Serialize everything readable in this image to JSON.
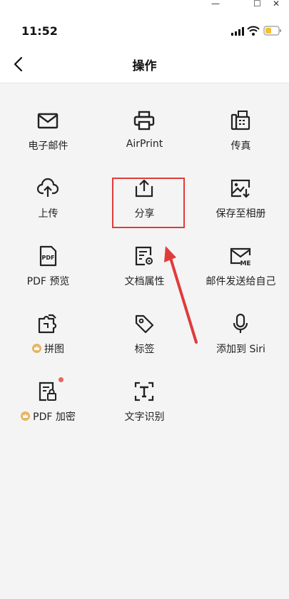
{
  "window": {
    "minimize": "—",
    "maximize": "☐",
    "close": "✕"
  },
  "status_bar": {
    "time": "11:52"
  },
  "nav": {
    "title": "操作"
  },
  "items": [
    {
      "label": "电子邮件",
      "icon": "mail-icon"
    },
    {
      "label": "AirPrint",
      "icon": "printer-icon"
    },
    {
      "label": "传真",
      "icon": "fax-icon"
    },
    {
      "label": "上传",
      "icon": "cloud-upload-icon"
    },
    {
      "label": "分享",
      "icon": "share-icon"
    },
    {
      "label": "保存至相册",
      "icon": "save-image-icon"
    },
    {
      "label": "PDF 预览",
      "icon": "pdf-preview-icon"
    },
    {
      "label": "文档属性",
      "icon": "doc-properties-icon"
    },
    {
      "label": "邮件发送给自己",
      "icon": "mail-me-icon"
    },
    {
      "label": "拼图",
      "icon": "puzzle-icon",
      "premium": true
    },
    {
      "label": "标签",
      "icon": "tag-icon"
    },
    {
      "label": "添加到 Siri",
      "icon": "microphone-icon"
    },
    {
      "label": "PDF 加密",
      "icon": "pdf-lock-icon",
      "premium": true,
      "badge": true
    },
    {
      "label": "文字识别",
      "icon": "text-recognition-icon"
    }
  ],
  "colors": {
    "highlight": "#e03b3b",
    "premium": "#e7b460",
    "badge": "#e7685e"
  }
}
